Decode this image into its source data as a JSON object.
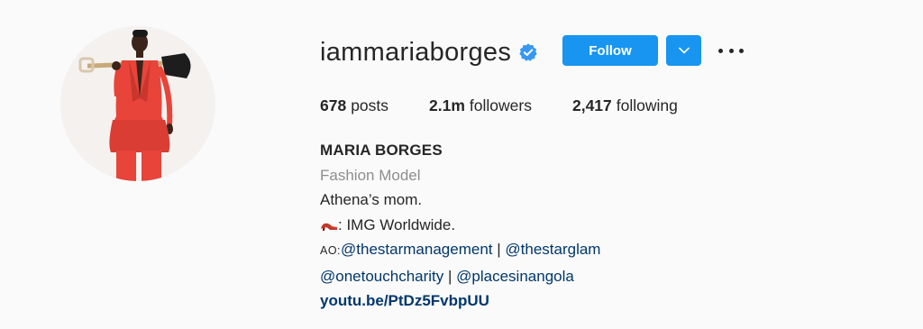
{
  "profile": {
    "username": "iammariaborges",
    "verified": true,
    "follow_label": "Follow",
    "stats": [
      {
        "value": "678",
        "label": "posts"
      },
      {
        "value": "2.1m",
        "label": "followers"
      },
      {
        "value": "2,417",
        "label": "following"
      }
    ],
    "name": "MARIA BORGES",
    "category": "Fashion Model",
    "bio_line1": "Athena’s mom.",
    "bio_line2_icon": "high-heel-icon",
    "bio_line2_text": ": IMG Worldwide.",
    "bio_line3_prefix": "AO:",
    "bio_line3_link1": "@thestarmanagement",
    "bio_line3_sep": " | ",
    "bio_line3_link2": "@thestarglam",
    "bio_line4_link1": "@onetouchcharity",
    "bio_line4_sep": " | ",
    "bio_line4_link2": "@placesinangola",
    "website": "youtu.be/PtDz5FvbpUU"
  },
  "colors": {
    "background": "#fafafa",
    "primary_button": "#1795f0",
    "link": "#00376b",
    "category": "#8e8e8e",
    "verified": "#3897f0",
    "suit": "#e8443a"
  }
}
